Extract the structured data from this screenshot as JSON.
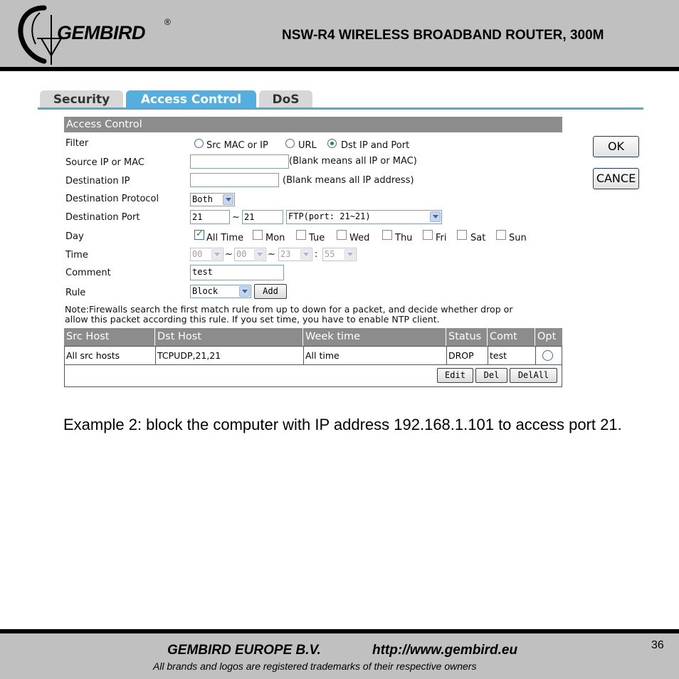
{
  "header": {
    "logo_text": "GEMBIRD",
    "registered_mark": "®",
    "title": "NSW-R4 WIRELESS BROADBAND ROUTER, 300M"
  },
  "tabs": [
    {
      "label": "Security",
      "active": false
    },
    {
      "label": "Access Control",
      "active": true
    },
    {
      "label": "DoS",
      "active": false
    }
  ],
  "panel": {
    "title": "Access Control",
    "labels": {
      "filter": "Filter",
      "source": "Source IP or MAC",
      "dest_ip": "Destination IP",
      "dest_proto": "Destination Protocol",
      "dest_port": "Destination Port",
      "day": "Day",
      "time": "Time",
      "comment": "Comment",
      "rule": "Rule"
    },
    "filter_options": [
      {
        "label": "Src MAC or IP",
        "selected": false
      },
      {
        "label": "URL",
        "selected": false
      },
      {
        "label": "Dst IP and Port",
        "selected": true
      }
    ],
    "source_value": "",
    "source_hint": "(Blank means all IP or MAC)",
    "dest_ip_value": "",
    "dest_ip_hint": "(Blank means all IP address)",
    "protocol": "Both",
    "port_from": "21",
    "port_tilde": "~",
    "port_to": "21",
    "port_preset": "FTP(port: 21~21)",
    "days": [
      {
        "label": "All Time",
        "checked": true
      },
      {
        "label": "Mon",
        "checked": false
      },
      {
        "label": "Tue",
        "checked": false
      },
      {
        "label": "Wed",
        "checked": false
      },
      {
        "label": "Thu",
        "checked": false
      },
      {
        "label": "Fri",
        "checked": false
      },
      {
        "label": "Sat",
        "checked": false
      },
      {
        "label": "Sun",
        "checked": false
      }
    ],
    "time": {
      "h1": "00",
      "m1": "00",
      "h2": "23",
      "m2": "55",
      "sep_tilde": "~",
      "sep_colon": ":"
    },
    "comment": "test",
    "rule": "Block",
    "add_label": "Add",
    "note_line1": "Note:Firewalls search the first match rule from up to down for a packet, and decide whether drop or",
    "note_line2": "allow this packet according this rule. If you set time, you have to enable NTP client.",
    "ok_label": "OK",
    "cancel_label": "CANCE"
  },
  "table": {
    "columns": [
      "Src Host",
      "Dst Host",
      "Week time",
      "Status",
      "Comt",
      "Opt"
    ],
    "rows": [
      [
        "All src hosts",
        "TCPUDP,21,21",
        "All time",
        "DROP",
        "test"
      ]
    ],
    "buttons": {
      "edit": "Edit",
      "del": "Del",
      "delall": "DelAll"
    }
  },
  "body_text": "Example 2: block the computer with IP address 192.168.1.101 to access port 21.",
  "footer": {
    "company": "GEMBIRD EUROPE B.V.",
    "url": "http://www.gembird.eu",
    "note": "All brands and logos are registered trademarks of their respective owners",
    "page_number": "36"
  },
  "colors": {
    "header_bg": "#c0c0c0",
    "tab_active": "#53afe0",
    "panel_header": "#8c8c8c"
  }
}
